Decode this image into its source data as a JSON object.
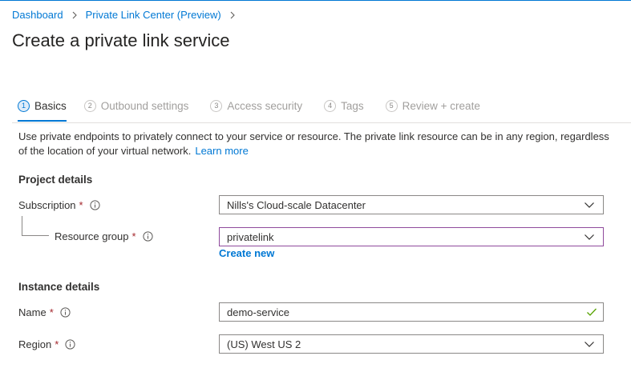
{
  "breadcrumb": {
    "items": [
      "Dashboard",
      "Private Link Center (Preview)"
    ]
  },
  "page": {
    "title": "Create a private link service"
  },
  "tabs": [
    {
      "num": "1",
      "label": "Basics",
      "active": true
    },
    {
      "num": "2",
      "label": "Outbound settings",
      "active": false
    },
    {
      "num": "3",
      "label": "Access security",
      "active": false
    },
    {
      "num": "4",
      "label": "Tags",
      "active": false
    },
    {
      "num": "5",
      "label": "Review + create",
      "active": false
    }
  ],
  "intro": {
    "text": "Use private endpoints to privately connect to your service or resource. The private link resource can be in any region, regardless of the location of your virtual network.",
    "link": "Learn more"
  },
  "project_details": {
    "heading": "Project details",
    "subscription": {
      "label": "Subscription",
      "required": "*",
      "value": "Nills's Cloud-scale Datacenter"
    },
    "resource_group": {
      "label": "Resource group",
      "required": "*",
      "value": "privatelink",
      "create_new": "Create new"
    }
  },
  "instance_details": {
    "heading": "Instance details",
    "name": {
      "label": "Name",
      "required": "*",
      "value": "demo-service"
    },
    "region": {
      "label": "Region",
      "required": "*",
      "value": "(US) West US 2"
    }
  },
  "colors": {
    "accent": "#0078d4",
    "required": "#a4262c",
    "valid_check": "#57a300",
    "focus_border": "#8f4a9c"
  },
  "icons": {
    "breadcrumb_separator": "chevron-right-icon",
    "info": "info-icon",
    "dropdown": "chevron-down-icon",
    "valid": "checkmark-icon"
  }
}
